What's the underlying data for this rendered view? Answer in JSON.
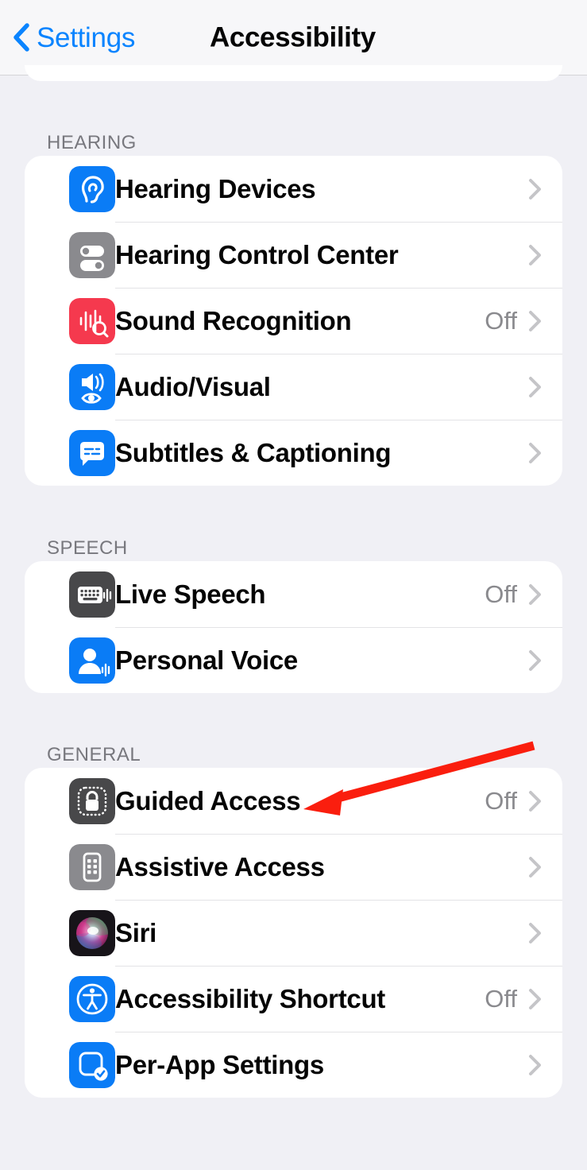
{
  "navbar": {
    "back_label": "Settings",
    "back_icon": "chevron-left-icon",
    "title": "Accessibility"
  },
  "sections": [
    {
      "header": "HEARING",
      "rows": [
        {
          "label": "Hearing Devices",
          "value": "",
          "icon": "ear-icon",
          "icon_color": "#0A7CF6"
        },
        {
          "label": "Hearing Control Center",
          "value": "",
          "icon": "toggles-icon",
          "icon_color": "#8A8A8E"
        },
        {
          "label": "Sound Recognition",
          "value": "Off",
          "icon": "waveform-magnifier-icon",
          "icon_color": "#F5394E"
        },
        {
          "label": "Audio/Visual",
          "value": "",
          "icon": "speaker-eye-icon",
          "icon_color": "#0A7CF6"
        },
        {
          "label": "Subtitles & Captioning",
          "value": "",
          "icon": "captions-bubble-icon",
          "icon_color": "#0A7CF6"
        }
      ]
    },
    {
      "header": "SPEECH",
      "rows": [
        {
          "label": "Live Speech",
          "value": "Off",
          "icon": "keyboard-waveform-icon",
          "icon_color": "#48484A"
        },
        {
          "label": "Personal Voice",
          "value": "",
          "icon": "person-waveform-icon",
          "icon_color": "#0A7CF6"
        }
      ]
    },
    {
      "header": "GENERAL",
      "rows": [
        {
          "label": "Guided Access",
          "value": "Off",
          "icon": "lock-dotted-icon",
          "icon_color": "#48484A"
        },
        {
          "label": "Assistive Access",
          "value": "",
          "icon": "device-grid-icon",
          "icon_color": "#8A8A8E"
        },
        {
          "label": "Siri",
          "value": "",
          "icon": "siri-orb-icon",
          "icon_color": "#1C1C1E"
        },
        {
          "label": "Accessibility Shortcut",
          "value": "Off",
          "icon": "accessibility-icon",
          "icon_color": "#0A7CF6"
        },
        {
          "label": "Per-App Settings",
          "value": "",
          "icon": "app-check-icon",
          "icon_color": "#0A7CF6"
        }
      ]
    }
  ],
  "annotation": {
    "type": "arrow",
    "color": "#FA1E0E",
    "points_to": "Guided Access"
  },
  "colors": {
    "background": "#F0F0F5",
    "card": "#FFFFFF",
    "accent_blue": "#0A84FF",
    "secondary_text": "#8A8A8E",
    "annotation_red": "#FA1E0E"
  }
}
